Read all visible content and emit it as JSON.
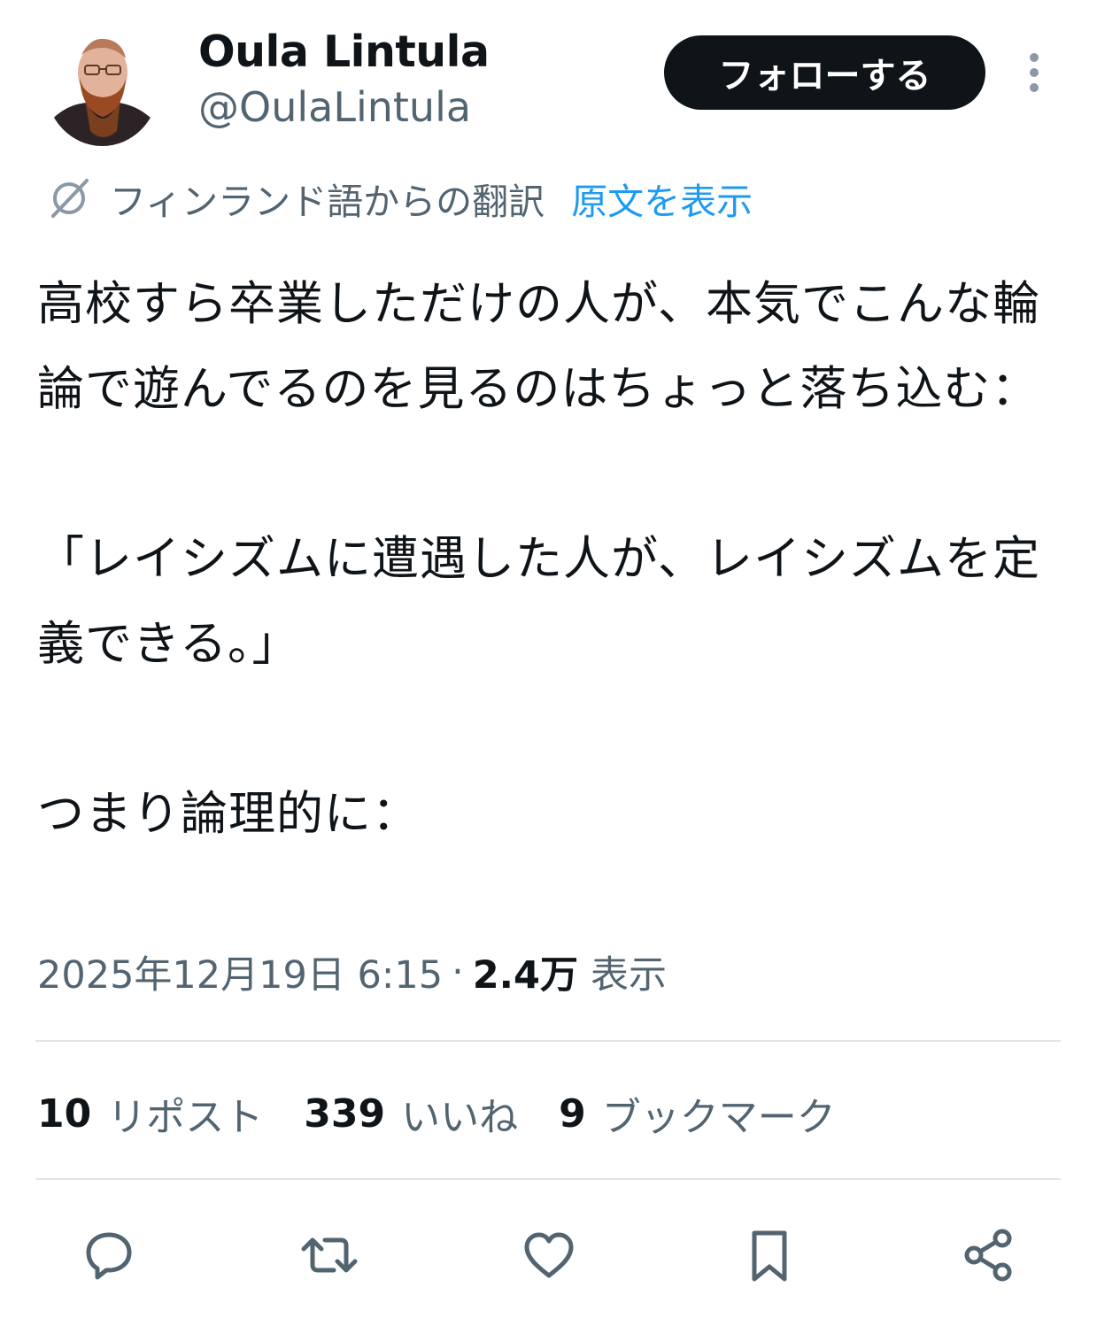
{
  "user": {
    "name": "Oula Lintula",
    "handle": "@OulaLintula",
    "follow_label": "フォローする"
  },
  "translation": {
    "label": "フィンランド語からの翻訳",
    "show_original": "原文を表示"
  },
  "post": {
    "text": "高校すら卒業しただけの人が、本気でこんな輪論で遊んでるのを見るのはちょっと落ち込む：\n\n「レイシズムに遭遇した人が、レイシズムを定義できる。」\n\nつまり論理的に："
  },
  "meta": {
    "datetime": "2025年12月19日 6:15",
    "separator": "·",
    "views_count": "2.4万",
    "views_label": "表示"
  },
  "stats": [
    {
      "count": "10",
      "label": "リポスト"
    },
    {
      "count": "339",
      "label": "いいね"
    },
    {
      "count": "9",
      "label": "ブックマーク"
    }
  ],
  "actions": [
    "reply-icon",
    "repost-icon",
    "like-icon",
    "bookmark-icon",
    "share-icon"
  ],
  "colors": {
    "text": "#0f1419",
    "secondary": "#536471",
    "link": "#1d9bf0",
    "follow_bg": "#0f1419",
    "divider": "#e1e6ea"
  }
}
